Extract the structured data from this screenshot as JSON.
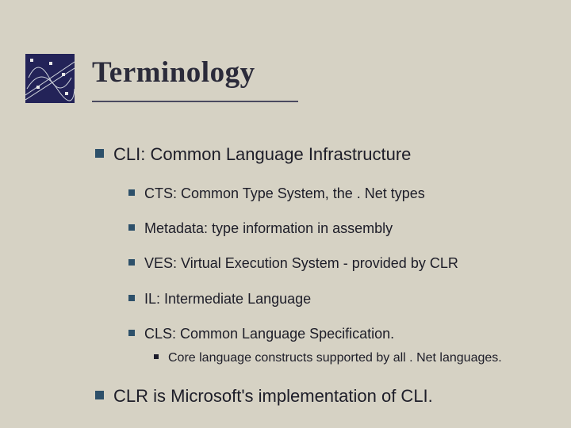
{
  "title": "Terminology",
  "bullets": {
    "cli": "CLI: Common Language Infrastructure",
    "sub": {
      "cts": "CTS: Common Type System, the . Net types",
      "metadata": "Metadata: type information in assembly",
      "ves": "VES: Virtual Execution System - provided by CLR",
      "il": "IL: Intermediate Language",
      "cls": "CLS: Common Language Specification."
    },
    "cls_detail": "Core language constructs supported by all . Net languages.",
    "clr": "CLR is Microsoft's implementation of CLI."
  }
}
